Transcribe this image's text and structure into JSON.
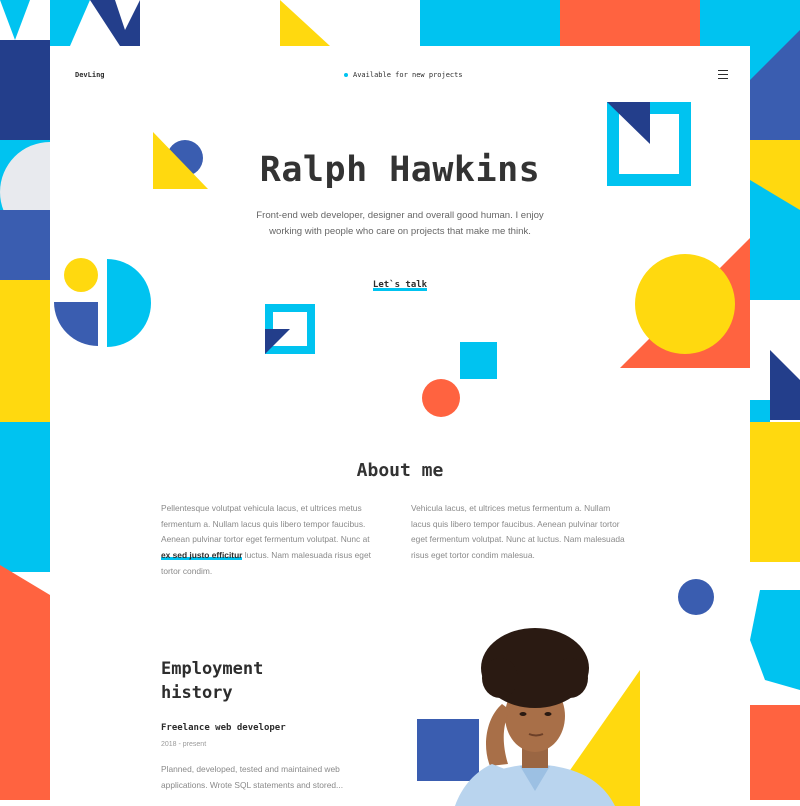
{
  "header": {
    "logo": "DevLing",
    "status_text": "Available for new projects",
    "menu_icon": "hamburger-menu-icon"
  },
  "hero": {
    "name": "Ralph Hawkins",
    "subtitle": "Front-end web developer, designer and overall good human. I enjoy working with people who care on projects that make me think.",
    "cta_label": "Let`s talk"
  },
  "about": {
    "title": "About me",
    "col1_before": "Pellentesque volutpat vehicula lacus, et ultrices metus fermentum a. Nullam lacus quis libero tempor faucibus. Aenean pulvinar tortor eget fermentum volutpat. Nunc at ",
    "col1_highlight": "ex sed justo efficitur",
    "col1_after": " luctus. Nam malesuada risus eget tortor condim.",
    "col2": "Vehicula lacus, et ultrices metus fermentum a. Nullam lacus quis libero tempor faucibus. Aenean pulvinar tortor eget fermentum volutpat. Nunc at luctus. Nam malesuada risus eget tortor condim malesua."
  },
  "employment": {
    "title": "Employment history",
    "job_title": "Freelance web developer",
    "job_dates": "2018 - present",
    "job_description": "Planned, developed, tested and maintained web applications. Wrote SQL statements and stored..."
  },
  "colors": {
    "blue": "#00c3f0",
    "navy": "#233e8b",
    "royal": "#3a5db0",
    "yellow": "#ffd90f",
    "orange": "#ff6340"
  }
}
